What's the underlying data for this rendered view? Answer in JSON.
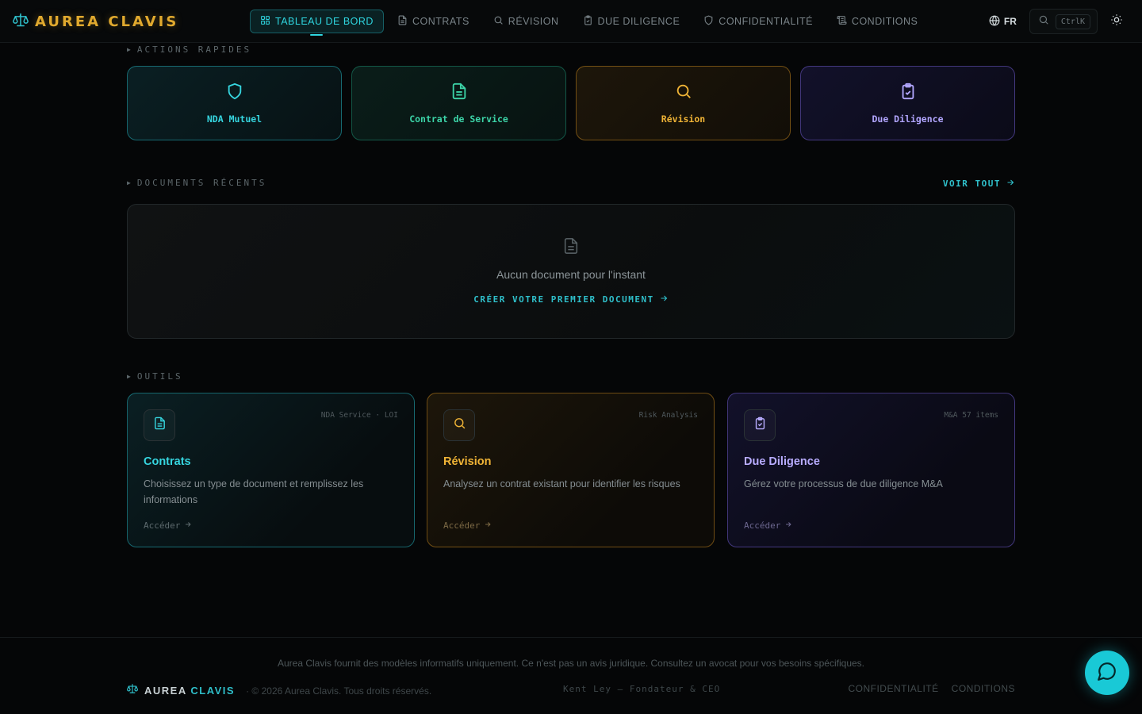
{
  "brand": {
    "name": "AUREA CLAVIS"
  },
  "nav": {
    "items": [
      {
        "label": "TABLEAU DE BORD",
        "icon": "dashboard-icon",
        "active": true
      },
      {
        "label": "CONTRATS",
        "icon": "document-icon"
      },
      {
        "label": "RÉVISION",
        "icon": "search-icon"
      },
      {
        "label": "DUE DILIGENCE",
        "icon": "clipboard-check-icon"
      },
      {
        "label": "CONFIDENTIALITÉ",
        "icon": "shield-icon"
      },
      {
        "label": "CONDITIONS",
        "icon": "scroll-icon"
      }
    ],
    "language": "FR",
    "search_shortcut": "CtrlK",
    "theme_icon": "sun-icon"
  },
  "quick_actions": {
    "label": "ACTIONS RAPIDES",
    "items": [
      {
        "label": "NDA Mutuel",
        "icon": "shield-icon",
        "color": "#36d6e0"
      },
      {
        "label": "Contrat de Service",
        "icon": "document-icon",
        "color": "#3cd4a8"
      },
      {
        "label": "Révision",
        "icon": "search-icon",
        "color": "#f0b436"
      },
      {
        "label": "Due Diligence",
        "icon": "clipboard-check-icon",
        "color": "#b2a6ff"
      }
    ]
  },
  "recent_documents": {
    "label": "DOCUMENTS RÉCENTS",
    "see_all": "VOIR TOUT",
    "empty_text": "Aucun document pour l'instant",
    "create_link": "CRÉER VOTRE PREMIER DOCUMENT"
  },
  "tools": {
    "label": "OUTILS",
    "items": [
      {
        "title": "Contrats",
        "tag": "NDA Service · LOI",
        "description": "Choisissez un type de document et remplissez les informations",
        "link": "Accéder",
        "icon": "document-icon",
        "color": "#36d6e0"
      },
      {
        "title": "Révision",
        "tag": "Risk Analysis",
        "description": "Analysez un contrat existant pour identifier les risques",
        "link": "Accéder",
        "icon": "search-icon",
        "color": "#f0b436"
      },
      {
        "title": "Due Diligence",
        "tag": "M&A 57 items",
        "description": "Gérez votre processus de due diligence M&A",
        "link": "Accéder",
        "icon": "clipboard-check-icon",
        "color": "#b8acff"
      }
    ]
  },
  "footer": {
    "disclaimer": "Aurea Clavis fournit des modèles informatifs uniquement. Ce n'est pas un avis juridique. Consultez un avocat pour vos besoins spécifiques.",
    "brand_first": "AUREA",
    "brand_second": "CLAVIS",
    "copyright": "· © 2026 Aurea Clavis. Tous droits réservés.",
    "founder": "Kent Ley — Fondateur & CEO",
    "links": [
      "CONFIDENTIALITÉ",
      "CONDITIONS"
    ]
  },
  "chat": {
    "icon": "chat-bubble-icon"
  }
}
